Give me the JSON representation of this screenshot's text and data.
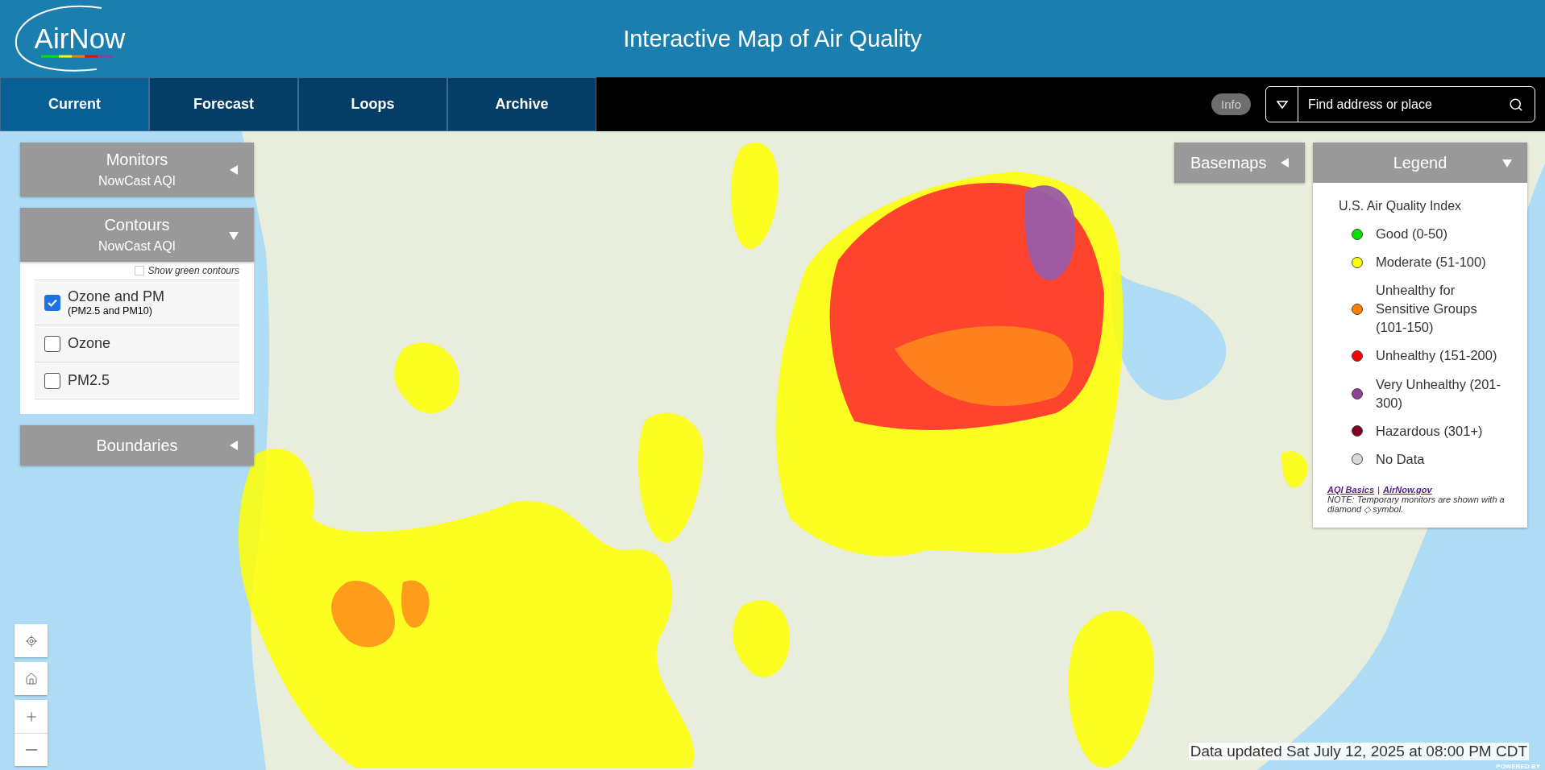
{
  "header": {
    "logo": "AirNow",
    "title": "Interactive Map of Air Quality"
  },
  "tabs": [
    {
      "label": "Current",
      "selected": true
    },
    {
      "label": "Forecast",
      "selected": false
    },
    {
      "label": "Loops",
      "selected": false
    },
    {
      "label": "Archive",
      "selected": false
    }
  ],
  "info_button": "Info",
  "search": {
    "placeholder": "Find address or place"
  },
  "panels": [
    {
      "title": "Monitors",
      "subtitle": "NowCast AQI",
      "expanded": false
    },
    {
      "title": "Contours",
      "subtitle": "NowCast AQI",
      "expanded": true,
      "show_green": {
        "label": "Show green contours",
        "checked": false
      },
      "options": [
        {
          "label": "Ozone and PM",
          "sublabel": "(PM2.5 and PM10)",
          "checked": true
        },
        {
          "label": "Ozone",
          "checked": false
        },
        {
          "label": "PM2.5",
          "checked": false
        }
      ]
    },
    {
      "title": "Boundaries",
      "expanded": false
    }
  ],
  "basemaps": {
    "title": "Basemaps",
    "expanded": false
  },
  "legend": {
    "title": "Legend",
    "expanded": true,
    "heading": "U.S. Air Quality Index",
    "items": [
      {
        "label": "Good (0-50)",
        "color": "#00e400"
      },
      {
        "label": "Moderate (51-100)",
        "color": "#ffff00"
      },
      {
        "label": "Unhealthy for Sensitive Groups (101-150)",
        "color": "#ff7e00"
      },
      {
        "label": "Unhealthy (151-200)",
        "color": "#ff0000"
      },
      {
        "label": "Very Unhealthy (201-300)",
        "color": "#8f3f97"
      },
      {
        "label": "Hazardous (301+)",
        "color": "#7e0023"
      },
      {
        "label": "No Data",
        "color": "#d9d9d9"
      }
    ],
    "links": [
      "AQI Basics",
      "AirNow.gov"
    ],
    "separator": "|",
    "note": "NOTE: Temporary monitors are shown with a diamond ◇ symbol."
  },
  "status": "Data updated Sat July 12, 2025 at 08:00 PM CDT",
  "attribution": "POWERED BY"
}
